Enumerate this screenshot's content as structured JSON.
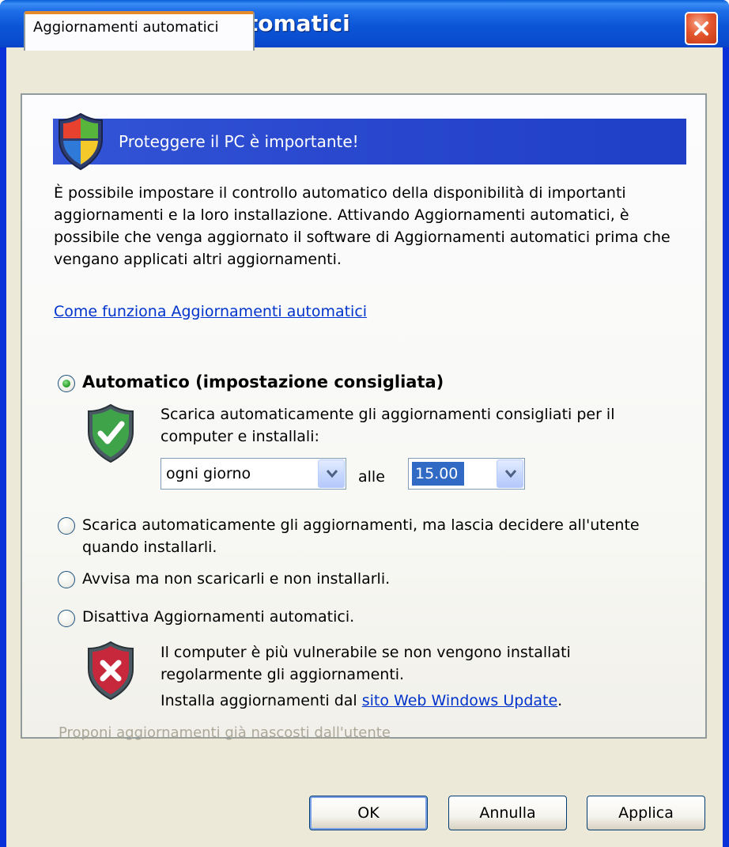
{
  "window": {
    "title": "Aggiornamenti automatici"
  },
  "tab": {
    "label": "Aggiornamenti automatici"
  },
  "banner": {
    "text": "Proteggere il PC è importante!"
  },
  "intro": "È possibile impostare il controllo automatico della disponibilità di importanti aggiornamenti e la loro installazione. Attivando Aggiornamenti automatici, è possibile che venga aggiornato il software di Aggiornamenti automatici prima che vengano applicati altri aggiornamenti.",
  "how_link": "Come funziona Aggiornamenti automatici",
  "options": {
    "automatic": {
      "label": "Automatico (impostazione consigliata)",
      "selected": true,
      "description": "Scarica automaticamente gli aggiornamenti consigliati per il computer e installali:"
    },
    "download_only": {
      "label": "Scarica automaticamente gli aggiornamenti, ma lascia decidere all'utente quando installarli.",
      "selected": false
    },
    "notify": {
      "label": "Avvisa ma non scaricarli e non installarli.",
      "selected": false
    },
    "disable": {
      "label": "Disattiva Aggiornamenti automatici.",
      "selected": false,
      "warning": "Il computer è più vulnerabile se non vengono installati regolarmente gli aggiornamenti.",
      "install_prefix": "Installa aggiornamenti dal ",
      "install_link": "sito Web Windows Update",
      "install_suffix": "."
    }
  },
  "schedule": {
    "day": "ogni giorno",
    "at_label": "alle",
    "time": "15.00"
  },
  "hidden_updates_link": "Proponi aggiornamenti già nascosti dall'utente",
  "buttons": {
    "ok": "OK",
    "cancel": "Annulla",
    "apply": "Applica"
  },
  "colors": {
    "titlebar": "#0a4cd0",
    "banner": "#2a49cf",
    "link": "#0033cc",
    "tab_accent": "#e68b2c",
    "disabled_text": "#aca899"
  },
  "icons": {
    "banner": "windows-security-shield-icon",
    "automatic": "green-check-shield-icon",
    "disable": "red-x-shield-icon",
    "close": "close-icon"
  }
}
